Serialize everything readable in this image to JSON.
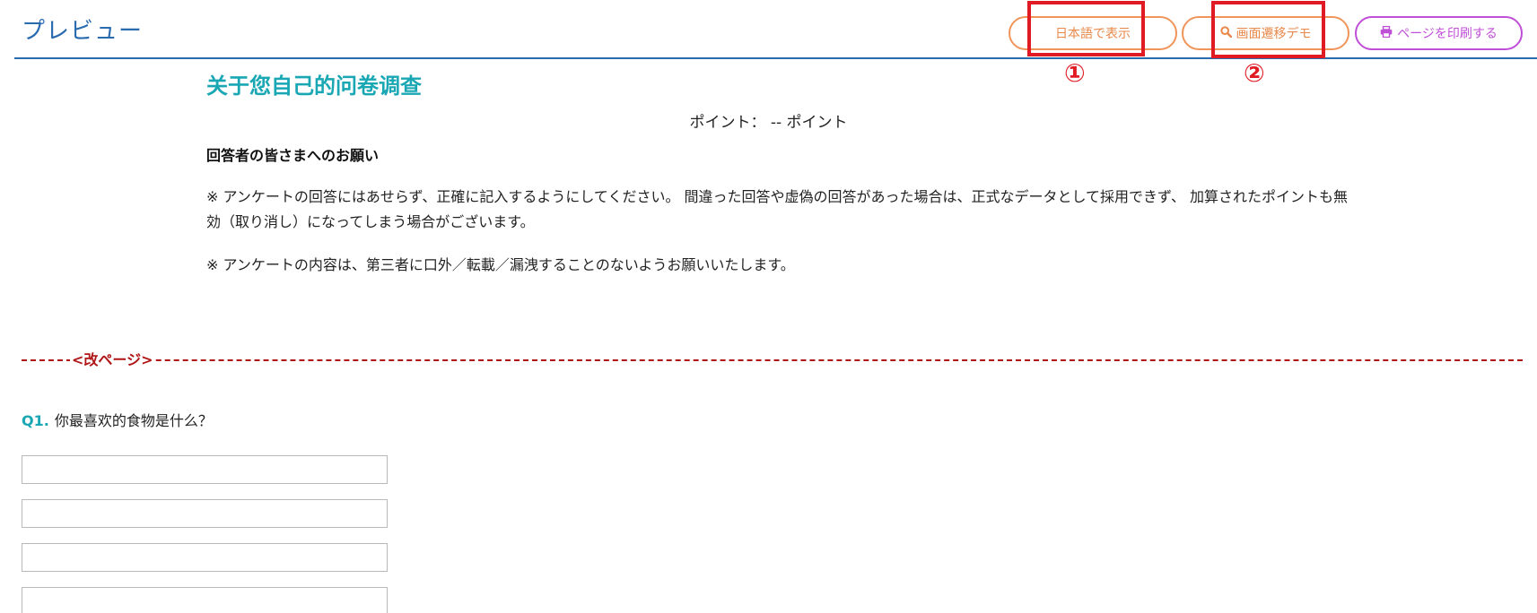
{
  "header": {
    "title": "プレビュー",
    "buttons": {
      "japanese_label": "日本語で表示",
      "demo_label": "画面遷移デモ",
      "print_label": "ページを印刷する"
    },
    "annotations": {
      "marker_1": "①",
      "marker_2": "②",
      "highlight_color": "#e01b24"
    }
  },
  "survey": {
    "title": "关于您自己的问卷调查",
    "points_text": "ポイント： -- ポイント",
    "notice_heading": "回答者の皆さまへのお願い",
    "notice_paragraph_1": "※ アンケートの回答にはあせらず、正確に記入するようにしてください。 間違った回答や虚偽の回答があった場合は、正式なデータとして採用できず、 加算されたポイントも無効（取り消し）になってしまう場合がございます。",
    "notice_paragraph_2": "※ アンケートの内容は、第三者に口外／転載／漏洩することのないようお願いいたします。",
    "page_break_label": "<改ページ>",
    "question": {
      "number": "Q1.",
      "text": "你最喜欢的食物是什么？",
      "answers": [
        "",
        "",
        "",
        ""
      ]
    }
  },
  "colors": {
    "header_blue": "#2a6bb0",
    "title_teal": "#1aa7b4",
    "orange_button": "#f0955a",
    "purple_button": "#c04fd8",
    "page_break_red": "#b01515"
  },
  "icons": {
    "demo_button": "search-icon",
    "print_button": "print-icon"
  }
}
